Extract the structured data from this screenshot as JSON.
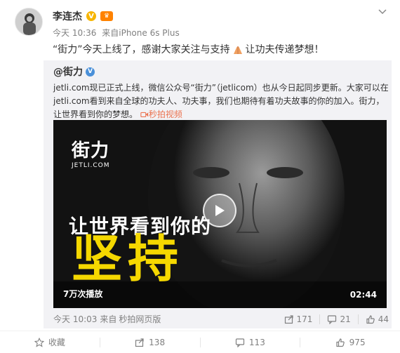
{
  "post": {
    "author": "李连杰",
    "meta": {
      "time": "今天 10:36",
      "source_prefix": "来自",
      "source": "iPhone 6s Plus"
    },
    "text_before": "“街力”今天上线了，感谢大家关注与支持",
    "text_after": "让功夫传递梦想！"
  },
  "forward": {
    "author": "@街力",
    "text_part1": "jetli.com现已正式上线，微信公众号“街力”（jetlicom）也从今日起同步更新。大家可以在jetli.com看到来自全球的功夫人、功夫事，我们也期待有着功夫故事的你的加入。街力，让世界看到你的梦想。",
    "video_link": "秒拍视频",
    "video": {
      "logo_main": "街力",
      "logo_sub": "JETLI.COM",
      "slogan": "让世界看到你的",
      "title": "坚持",
      "play_count": "7万次播放",
      "duration": "02:44"
    },
    "footer": {
      "time": "今天 10:03",
      "source_prefix": "来自",
      "source": "秒拍网页版",
      "shares": "171",
      "comments": "21",
      "likes": "44"
    }
  },
  "actions": {
    "favorite": "收藏",
    "share": "138",
    "comment": "113",
    "like": "975"
  },
  "colors": {
    "link": "#eb7350",
    "meta": "#808080",
    "accent_yellow": "#f5d800"
  }
}
